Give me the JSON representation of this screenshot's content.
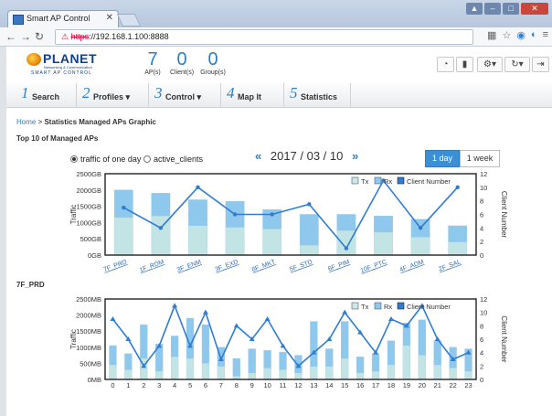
{
  "browser": {
    "tab_title": "Smart AP Control",
    "url_scheme": "https",
    "url_rest": "://192.168.1.100:8888"
  },
  "brand": {
    "name": "PLANET",
    "tagline": "Networking & Communication",
    "product": "SMART AP CONTROL"
  },
  "stats": [
    {
      "value": "7",
      "label": "AP(s)"
    },
    {
      "value": "0",
      "label": "Client(s)"
    },
    {
      "value": "0",
      "label": "Group(s)"
    }
  ],
  "menu": [
    {
      "num": "1",
      "label": "Search"
    },
    {
      "num": "2",
      "label": "Profiles ▾"
    },
    {
      "num": "3",
      "label": "Control ▾"
    },
    {
      "num": "4",
      "label": "Map It"
    },
    {
      "num": "5",
      "label": "Statistics"
    }
  ],
  "breadcrumb": {
    "home": "Home",
    "sep": " > ",
    "current": "Statistics Managed APs Graphic"
  },
  "section_title": "Top 10 of Managed APs",
  "radios": [
    {
      "label": "traffic of one day",
      "checked": true
    },
    {
      "label": "active_clients",
      "checked": false
    }
  ],
  "date": {
    "prev": "«",
    "value": "2017 / 03 / 10",
    "next": "»"
  },
  "range_buttons": [
    {
      "label": "1 day",
      "active": true
    },
    {
      "label": "1 week",
      "active": false
    }
  ],
  "second_chart_title": "7F_PRD",
  "colors": {
    "tx": "#cde9e3",
    "rx": "#8ec8ec",
    "line": "#2f7dd1",
    "frame": "#222222"
  },
  "chart_data": [
    {
      "type": "bar",
      "title": "",
      "ylabel": "Traffic",
      "y2label": "Client Number",
      "yticks": [
        "0GB",
        "500GB",
        "1000GB",
        "1500GB",
        "2000GB",
        "2500GB"
      ],
      "y2ticks": [
        "0",
        "2",
        "4",
        "6",
        "8",
        "10",
        "12"
      ],
      "ylim": [
        0,
        2500
      ],
      "y2lim": [
        0,
        12
      ],
      "legend": [
        "Tx",
        "Rx",
        "Client Number"
      ],
      "legend_position": "top-right",
      "categories": [
        "7F_PRD",
        "1F_RDM",
        "3F_ENM",
        "3F_EXD",
        "8F_MKT",
        "5F_STD",
        "6F_PIM",
        "10F_PTC",
        "4F_ADM",
        "2F_SAL"
      ],
      "series": [
        {
          "name": "Tx",
          "values": [
            1150,
            1200,
            900,
            850,
            800,
            300,
            750,
            700,
            550,
            400
          ]
        },
        {
          "name": "Rx",
          "values": [
            2000,
            1900,
            1700,
            1650,
            1400,
            1250,
            1250,
            1200,
            1100,
            900
          ]
        },
        {
          "name": "Client Number",
          "values": [
            7,
            4,
            10,
            6,
            6,
            7.5,
            1,
            11,
            4,
            10
          ]
        }
      ]
    },
    {
      "type": "bar",
      "title": "",
      "ylabel": "Traffic",
      "y2label": "Client Number",
      "yticks": [
        "0MB",
        "500MB",
        "1000MB",
        "1500MB",
        "2000MB",
        "2500MB"
      ],
      "y2ticks": [
        "0",
        "2",
        "4",
        "6",
        "8",
        "10",
        "12"
      ],
      "ylim": [
        0,
        2500
      ],
      "y2lim": [
        0,
        12
      ],
      "legend": [
        "Tx",
        "Rx",
        "Client Number"
      ],
      "legend_position": "top-right",
      "categories": [
        "0",
        "1",
        "2",
        "3",
        "4",
        "5",
        "6",
        "7",
        "8",
        "9",
        "10",
        "11",
        "12",
        "13",
        "14",
        "15",
        "16",
        "17",
        "18",
        "19",
        "20",
        "21",
        "22",
        "23"
      ],
      "series": [
        {
          "name": "Tx",
          "values": [
            450,
            300,
            650,
            250,
            700,
            650,
            500,
            400,
            100,
            200,
            350,
            300,
            200,
            400,
            400,
            650,
            200,
            250,
            450,
            1050,
            750,
            450,
            350,
            250
          ]
        },
        {
          "name": "Rx",
          "values": [
            1050,
            800,
            1700,
            1100,
            1350,
            1900,
            1700,
            1000,
            650,
            950,
            900,
            850,
            750,
            1800,
            950,
            1800,
            700,
            800,
            1200,
            1750,
            1850,
            1200,
            1000,
            950
          ]
        },
        {
          "name": "Client Number",
          "values": [
            9,
            6,
            2,
            5,
            11,
            5,
            10,
            3,
            8,
            6,
            9,
            5,
            2,
            4,
            6,
            10,
            7,
            4,
            9,
            8,
            11,
            6,
            3,
            4
          ]
        }
      ]
    }
  ]
}
